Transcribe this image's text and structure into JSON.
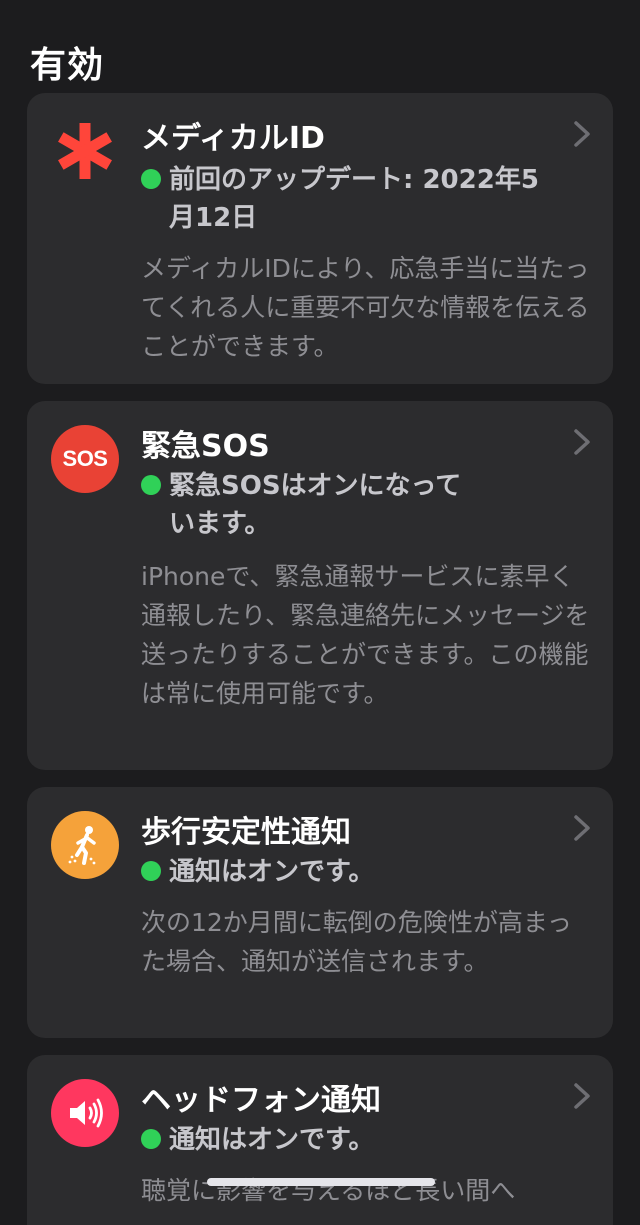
{
  "section": {
    "title": "有効"
  },
  "colors": {
    "background": "#1c1c1e",
    "card": "#2c2c2e",
    "status_dot": "#30d158",
    "medical_red": "#ff453a",
    "sos_red": "#e94235",
    "walking_orange": "#f5a23a",
    "headphone_pink": "#ff375f"
  },
  "cards": [
    {
      "title": "メディカルID",
      "icon": "medical-asterisk-icon",
      "status_line1": "前回のアップデート: 2022年5",
      "status_line2": "月12日",
      "description": "メディカルIDにより、応急手当に当たってくれる人に重要不可欠な情報を伝えることができます。"
    },
    {
      "title": "緊急SOS",
      "icon": "sos-icon",
      "icon_text": "SOS",
      "status_line1": "緊急SOSはオンになって",
      "status_line2": "います。",
      "description": "iPhoneで、緊急通報サービスに素早く通報したり、緊急連絡先にメッセージを送ったりすることができます。この機能は常に使用可能です。"
    },
    {
      "title": "歩行安定性通知",
      "icon": "walking-person-icon",
      "status_line1": "通知はオンです。",
      "description": "次の12か月間に転倒の危険性が高まった場合、通知が送信されます。"
    },
    {
      "title": "ヘッドフォン通知",
      "icon": "speaker-sound-icon",
      "status_line1": "通知はオンです。",
      "description": "聴覚に影響を与えるほど長い間へ"
    }
  ]
}
